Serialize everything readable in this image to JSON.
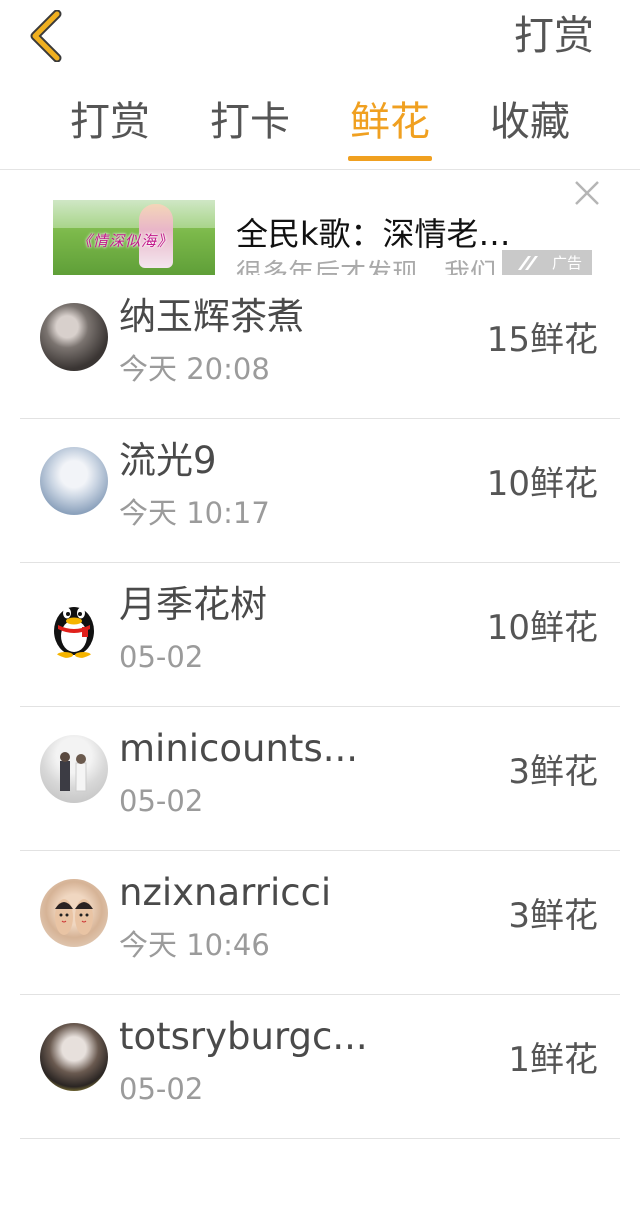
{
  "header": {
    "back_icon": "chevron-left-icon",
    "action_label": "打赏",
    "accent_color": "#f0a020"
  },
  "tabs": [
    {
      "label": "打赏",
      "active": false
    },
    {
      "label": "打卡",
      "active": false
    },
    {
      "label": "鲜花",
      "active": true
    },
    {
      "label": "收藏",
      "active": false
    }
  ],
  "ad": {
    "thumb_text": "《情深似海》",
    "title": "全民k歌：深情老…",
    "subtitle": "很多年后才发现，我们",
    "badge": "广告",
    "close_icon": "close-icon"
  },
  "list": [
    {
      "name": "纳玉辉茶煮",
      "time": "今天 20:08",
      "count": "15鲜花"
    },
    {
      "name": "流光9",
      "time": "今天 10:17",
      "count": "10鲜花"
    },
    {
      "name": "月季花树",
      "time": "05-02",
      "count": "10鲜花"
    },
    {
      "name": "minicounts...",
      "time": "05-02",
      "count": "3鲜花"
    },
    {
      "name": "nzixnarricci",
      "time": "今天 10:46",
      "count": "3鲜花"
    },
    {
      "name": "totsryburgc...",
      "time": "05-02",
      "count": "1鲜花"
    }
  ]
}
